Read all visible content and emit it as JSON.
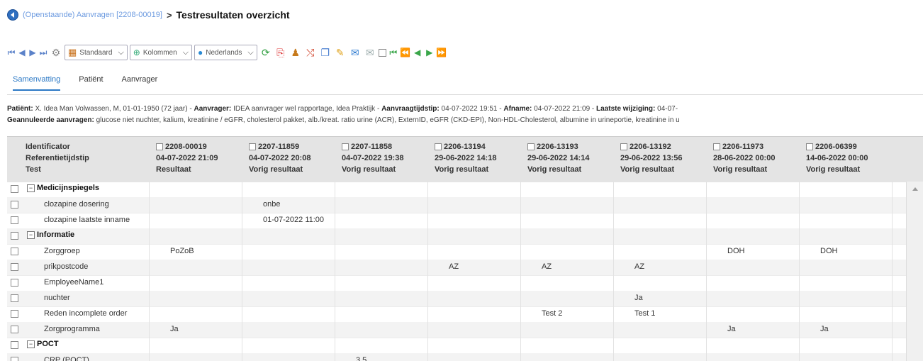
{
  "breadcrumb": {
    "parent": "(Openstaande) Aanvragen [2208-00019]",
    "separator": ">",
    "title": "Testresultaten overzicht"
  },
  "toolbar": {
    "view_dropdown": {
      "value": "Standaard"
    },
    "columns_dropdown": {
      "value": "Kolommen"
    },
    "language_dropdown": {
      "value": "Nederlands"
    }
  },
  "tabs": [
    {
      "label": "Samenvatting",
      "active": true
    },
    {
      "label": "Patiënt"
    },
    {
      "label": "Aanvrager"
    }
  ],
  "info": {
    "line1": [
      {
        "label": "Patiënt:",
        "value": "X. Idea Man Volwassen, M, 01-01-1950 (72 jaar) -"
      },
      {
        "label": "Aanvrager:",
        "value": "IDEA aanvrager wel rapportage, Idea Praktijk -"
      },
      {
        "label": "Aanvraagtijdstip:",
        "value": "04-07-2022 19:51 -"
      },
      {
        "label": "Afname:",
        "value": "04-07-2022 21:09 -"
      },
      {
        "label": "Laatste wijziging:",
        "value": "04-07-"
      }
    ],
    "line2": [
      {
        "label": "Geannuleerde aanvragen:",
        "value": "glucose niet nuchter, kalium, kreatinine / eGFR, cholesterol pakket, alb./kreat. ratio urine (ACR), ExternID, eGFR (CKD-EPI), Non-HDL-Cholesterol, albumine in urineportie, kreatinine in u"
      }
    ]
  },
  "grid": {
    "header": {
      "line1": "Identificator",
      "line2": "Referentietijdstip",
      "line3": "Test"
    },
    "columns": [
      {
        "id": "2208-00019",
        "time": "04-07-2022 21:09",
        "kind": "Resultaat"
      },
      {
        "id": "2207-11859",
        "time": "04-07-2022 20:08",
        "kind": "Vorig resultaat"
      },
      {
        "id": "2207-11858",
        "time": "04-07-2022 19:38",
        "kind": "Vorig resultaat"
      },
      {
        "id": "2206-13194",
        "time": "29-06-2022 14:18",
        "kind": "Vorig resultaat"
      },
      {
        "id": "2206-13193",
        "time": "29-06-2022 14:14",
        "kind": "Vorig resultaat"
      },
      {
        "id": "2206-13192",
        "time": "29-06-2022 13:56",
        "kind": "Vorig resultaat"
      },
      {
        "id": "2206-11973",
        "time": "28-06-2022 00:00",
        "kind": "Vorig resultaat"
      },
      {
        "id": "2206-06399",
        "time": "14-06-2022 00:00",
        "kind": "Vorig resultaat"
      }
    ],
    "rows": [
      {
        "type": "group",
        "label": "Medicijnspiegels",
        "toggle": "⊟"
      },
      {
        "type": "item",
        "label": "clozapine dosering",
        "values": [
          "",
          "onbe",
          "",
          "",
          "",
          "",
          "",
          ""
        ]
      },
      {
        "type": "item",
        "label": "clozapine laatste inname",
        "values": [
          "",
          "01-07-2022 11:00",
          "",
          "",
          "",
          "",
          "",
          ""
        ]
      },
      {
        "type": "group",
        "label": "Informatie",
        "toggle": "⊟"
      },
      {
        "type": "item",
        "label": "Zorggroep",
        "values": [
          "PoZoB",
          "",
          "",
          "",
          "",
          "",
          "DOH",
          "DOH"
        ]
      },
      {
        "type": "item",
        "label": "prikpostcode",
        "values": [
          "",
          "",
          "",
          "AZ",
          "AZ",
          "AZ",
          "",
          ""
        ]
      },
      {
        "type": "item",
        "label": "EmployeeName1",
        "values": [
          "",
          "",
          "",
          "",
          "",
          "",
          "",
          ""
        ]
      },
      {
        "type": "item",
        "label": "nuchter",
        "values": [
          "",
          "",
          "",
          "",
          "",
          "Ja",
          "",
          ""
        ]
      },
      {
        "type": "item",
        "label": "Reden incomplete order",
        "values": [
          "",
          "",
          "",
          "",
          "Test 2",
          "Test 1",
          "",
          ""
        ]
      },
      {
        "type": "item",
        "label": "Zorgprogramma",
        "values": [
          "Ja",
          "",
          "",
          "",
          "",
          "",
          "Ja",
          "Ja"
        ]
      },
      {
        "type": "group",
        "label": "POCT",
        "toggle": "⊟"
      },
      {
        "type": "item",
        "label": "CRP (POCT)",
        "values": [
          "",
          "",
          "3.5",
          "",
          "",
          "",
          "",
          ""
        ]
      }
    ]
  }
}
